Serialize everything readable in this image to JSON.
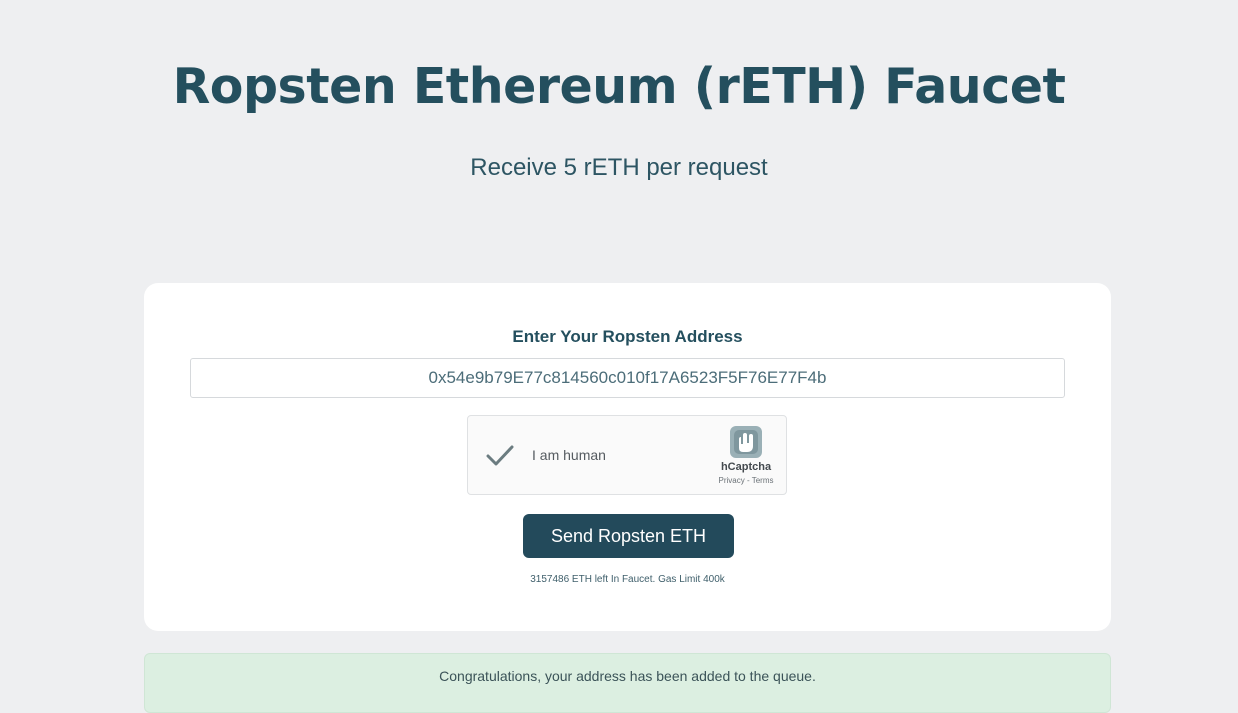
{
  "header": {
    "title": "Ropsten Ethereum (rETH) Faucet",
    "subtitle": "Receive 5 rETH per request"
  },
  "form": {
    "label": "Enter Your Ropsten Address",
    "address_value": "0x54e9b79E77c814560c010f17A6523F5F76E77F4b",
    "send_label": "Send Ropsten ETH",
    "faucet_info": "3157486 ETH left In Faucet. Gas Limit 400k"
  },
  "captcha": {
    "label": "I am human",
    "brand": "hCaptcha",
    "privacy": "Privacy",
    "separator": " - ",
    "terms": "Terms",
    "checked": true,
    "check_color": "#6b7c80",
    "icons": {
      "check": "check-icon",
      "logo": "hcaptcha-logo-icon"
    }
  },
  "notice": {
    "message": "Congratulations, your address has been added to the queue."
  },
  "colors": {
    "background": "#eeeff1",
    "title": "#244f5e",
    "button": "#234a5b",
    "banner": "#dcefe1"
  }
}
